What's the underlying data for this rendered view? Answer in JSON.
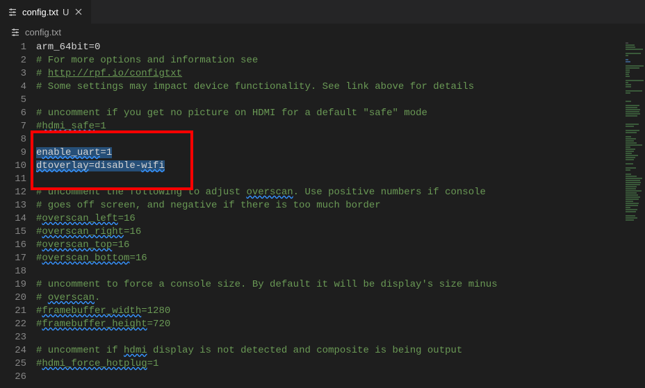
{
  "tab": {
    "filename": "config.txt",
    "modified_badge": "U"
  },
  "breadcrumb": {
    "filename": "config.txt"
  },
  "code": {
    "lines": [
      {
        "n": 1,
        "type": "plain",
        "text": "arm_64bit=0"
      },
      {
        "n": 2,
        "type": "comment",
        "text": "# For more options and information see"
      },
      {
        "n": 3,
        "type": "link",
        "prefix": "# ",
        "linktext": "http://rpf.io/configtxt"
      },
      {
        "n": 4,
        "type": "comment",
        "text": "# Some settings may impact device functionality. See link above for details"
      },
      {
        "n": 5,
        "type": "blank",
        "text": ""
      },
      {
        "n": 6,
        "type": "comment",
        "text": "# uncomment if you get no picture on HDMI for a default \"safe\" mode"
      },
      {
        "n": 7,
        "type": "wavycomment",
        "seg": [
          {
            "t": "#",
            "w": false
          },
          {
            "t": "hdmi_safe",
            "w": true
          },
          {
            "t": "=1",
            "w": false
          }
        ]
      },
      {
        "n": 8,
        "type": "blank",
        "text": ""
      },
      {
        "n": 9,
        "type": "selwavy",
        "seg": [
          {
            "t": "e",
            "w": false,
            "sel": true
          },
          {
            "t": "nable_uart",
            "w": true,
            "sel": true
          },
          {
            "t": "=1",
            "w": false,
            "sel": true
          }
        ]
      },
      {
        "n": 10,
        "type": "selwavy",
        "seg": [
          {
            "t": "dtoverlay",
            "w": true,
            "sel": true
          },
          {
            "t": "=disable-",
            "w": false,
            "sel": true
          },
          {
            "t": "wifi",
            "w": true,
            "sel": true
          }
        ]
      },
      {
        "n": 11,
        "type": "blank",
        "text": ""
      },
      {
        "n": 12,
        "type": "comment_wavy",
        "seg": [
          {
            "t": "# uncomment the following to adjust ",
            "w": false
          },
          {
            "t": "overscan",
            "w": true
          },
          {
            "t": ". Use positive numbers if console",
            "w": false
          }
        ]
      },
      {
        "n": 13,
        "type": "comment",
        "text": "# goes off screen, and negative if there is too much border"
      },
      {
        "n": 14,
        "type": "wavycomment",
        "seg": [
          {
            "t": "#",
            "w": false
          },
          {
            "t": "overscan_left",
            "w": true
          },
          {
            "t": "=16",
            "w": false
          }
        ]
      },
      {
        "n": 15,
        "type": "wavycomment",
        "seg": [
          {
            "t": "#",
            "w": false
          },
          {
            "t": "overscan_right",
            "w": true
          },
          {
            "t": "=16",
            "w": false
          }
        ]
      },
      {
        "n": 16,
        "type": "wavycomment",
        "seg": [
          {
            "t": "#",
            "w": false
          },
          {
            "t": "overscan_top",
            "w": true
          },
          {
            "t": "=16",
            "w": false
          }
        ]
      },
      {
        "n": 17,
        "type": "wavycomment",
        "seg": [
          {
            "t": "#",
            "w": false
          },
          {
            "t": "overscan_bottom",
            "w": true
          },
          {
            "t": "=16",
            "w": false
          }
        ]
      },
      {
        "n": 18,
        "type": "blank",
        "text": ""
      },
      {
        "n": 19,
        "type": "comment",
        "text": "# uncomment to force a console size. By default it will be display's size minus"
      },
      {
        "n": 20,
        "type": "comment_wavy",
        "seg": [
          {
            "t": "# ",
            "w": false
          },
          {
            "t": "overscan",
            "w": true
          },
          {
            "t": ".",
            "w": false
          }
        ]
      },
      {
        "n": 21,
        "type": "wavycomment",
        "seg": [
          {
            "t": "#",
            "w": false
          },
          {
            "t": "framebuffer_width",
            "w": true
          },
          {
            "t": "=1280",
            "w": false
          }
        ]
      },
      {
        "n": 22,
        "type": "wavycomment",
        "seg": [
          {
            "t": "#",
            "w": false
          },
          {
            "t": "framebuffer_height",
            "w": true
          },
          {
            "t": "=720",
            "w": false
          }
        ]
      },
      {
        "n": 23,
        "type": "blank",
        "text": ""
      },
      {
        "n": 24,
        "type": "comment_wavy",
        "seg": [
          {
            "t": "# uncomment if ",
            "w": false
          },
          {
            "t": "hdmi",
            "w": true
          },
          {
            "t": " display is not detected and composite is being output",
            "w": false
          }
        ]
      },
      {
        "n": 25,
        "type": "wavycomment",
        "seg": [
          {
            "t": "#",
            "w": false
          },
          {
            "t": "hdmi_force_hotplug",
            "w": true
          },
          {
            "t": "=1",
            "w": false
          }
        ]
      },
      {
        "n": 26,
        "type": "blank",
        "text": ""
      }
    ]
  },
  "colors": {
    "bg": "#1e1e1e",
    "comment": "#6a9955",
    "selection": "#264f78",
    "wavy": "#3794ff",
    "highlight_box": "#ff0000"
  }
}
